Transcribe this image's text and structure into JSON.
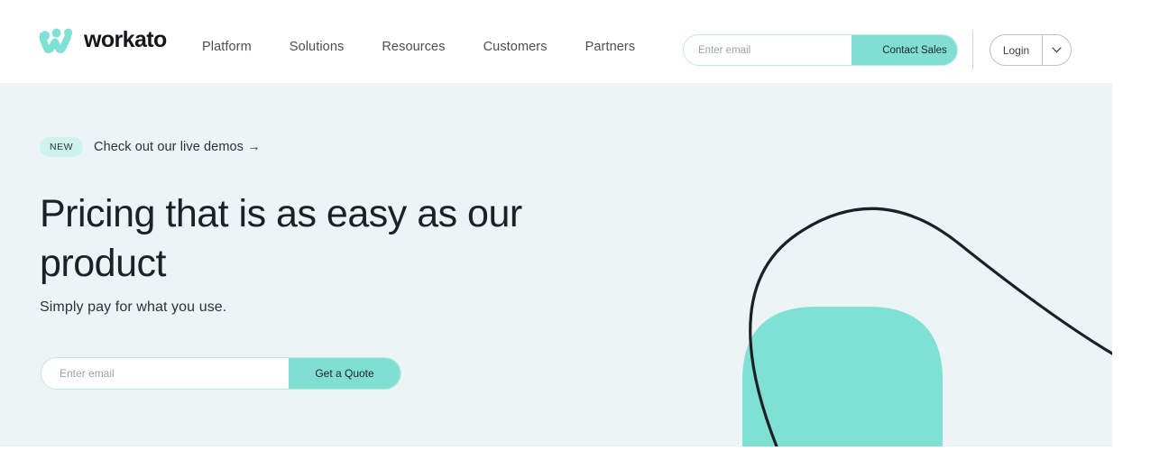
{
  "header": {
    "logo": {
      "icon": "workato-w-logo-icon",
      "text": "workato",
      "color": "#7fe0d4"
    },
    "nav": [
      {
        "label": "Platform"
      },
      {
        "label": "Solutions"
      },
      {
        "label": "Resources"
      },
      {
        "label": "Customers"
      },
      {
        "label": "Partners"
      }
    ],
    "email_form": {
      "placeholder": "Enter email",
      "value": "",
      "button_label": "Contact Sales"
    },
    "login": {
      "label": "Login",
      "caret_icon": "chevron-down-icon"
    }
  },
  "hero": {
    "background": "#ecf4f5",
    "announcement": {
      "badge": "NEW",
      "text": "Check out our live demos  →"
    },
    "title": "Pricing that is as easy as our product",
    "subtitle": "Simply pay for what you use.",
    "email_form": {
      "placeholder": "Enter email",
      "value": "",
      "button_label": "Get a Quote"
    },
    "decoration": {
      "arc_color": "#1d2126",
      "blob_color": "#7fe0d4"
    }
  }
}
